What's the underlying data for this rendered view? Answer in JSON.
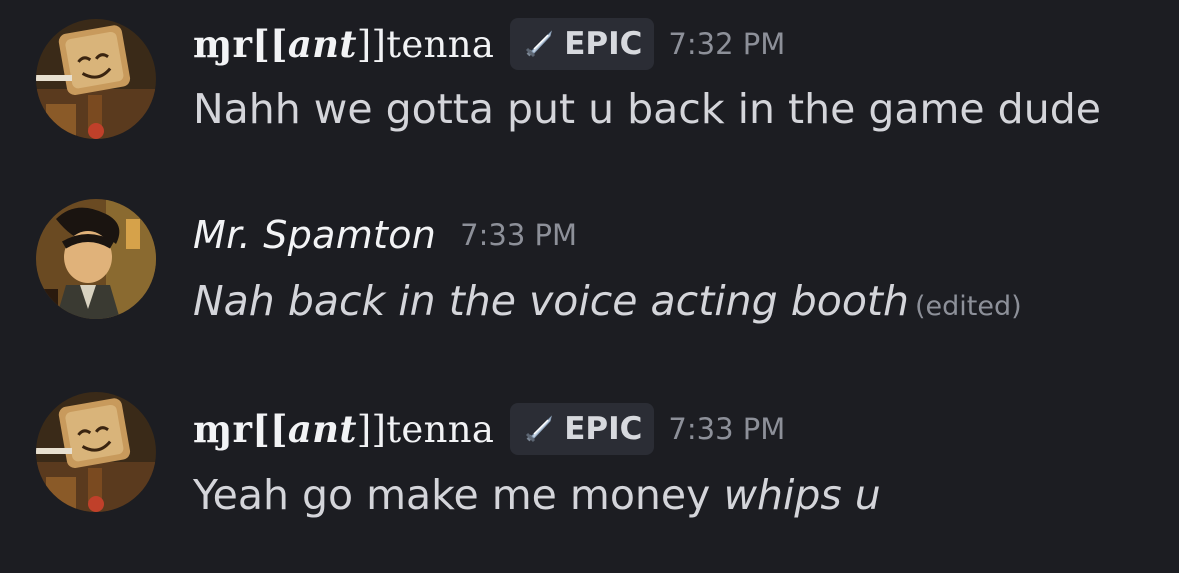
{
  "messages": [
    {
      "author": "tenna",
      "username": {
        "prefix": "ɱr[[",
        "fancy": "ant",
        "suffix": "]]tenna"
      },
      "badge": {
        "icon": "sword-icon",
        "label": "EPIC"
      },
      "timestamp": "7:32 PM",
      "text": "Nahh we gotta put u back in the game dude"
    },
    {
      "author": "spamton",
      "username": "Mr. Spamton",
      "timestamp": "7:33 PM",
      "text": "Nah back in the voice acting booth",
      "edited_label": "(edited)"
    },
    {
      "author": "tenna",
      "username": {
        "prefix": "ɱr[[",
        "fancy": "ant",
        "suffix": "]]tenna"
      },
      "badge": {
        "icon": "sword-icon",
        "label": "EPIC"
      },
      "timestamp": "7:33 PM",
      "text": "Yeah go make me money ",
      "text_emphasis": "whips u"
    }
  ],
  "colors": {
    "background": "#1c1d22",
    "username": "#f2f3f5",
    "timestamp": "#8d9099",
    "badge_bg": "#2b2d35",
    "text": "#d4d5da"
  }
}
